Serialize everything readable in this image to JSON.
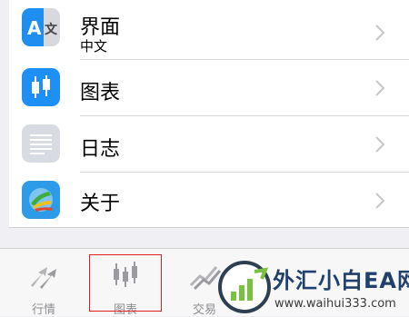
{
  "settings": {
    "items": [
      {
        "label": "界面",
        "sublabel": "中文",
        "icon": "translate-icon"
      },
      {
        "label": "图表",
        "icon": "candlestick-chart-icon"
      },
      {
        "label": "日志",
        "icon": "journal-icon"
      },
      {
        "label": "关于",
        "icon": "metatrader-logo-icon"
      }
    ]
  },
  "tabbar": {
    "tabs": [
      {
        "label": "行情",
        "icon": "quotes-arrows-icon"
      },
      {
        "label": "图表",
        "icon": "candlestick-icon",
        "highlighted": true
      },
      {
        "label": "交易",
        "icon": "trade-line-icon"
      }
    ]
  },
  "watermark": {
    "brand": "外汇小白EA网",
    "url": "www.waihui333.com"
  },
  "colors": {
    "accent_blue": "#1e90f5",
    "chevron": "#c7c7cc",
    "tab_inactive": "#8e8e93",
    "highlight_box": "#e01e1e"
  }
}
